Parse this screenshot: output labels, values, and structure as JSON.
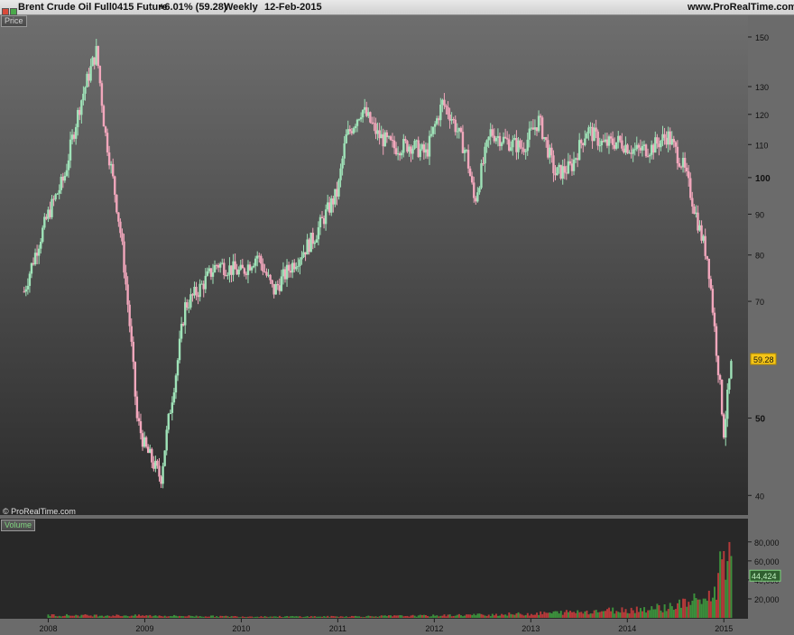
{
  "window": {
    "instrument": "Brent Crude Oil Full0415 Future",
    "change": "+6.01% (59.28)",
    "period": "Weekly",
    "date": "12-Feb-2015",
    "site": "www.ProRealTime.com"
  },
  "panes": {
    "price_label": "Price",
    "volume_label": "Volume",
    "watermark": "© ProRealTime.com"
  },
  "colors": {
    "up": "#9fe3b8",
    "down": "#f2a7bc",
    "vol_up": "#3c8f3c",
    "vol_down": "#b63a3a",
    "last_price_bg": "#f5c518"
  },
  "chart_data": [
    {
      "type": "candlestick",
      "title": "Price",
      "scale": "log",
      "ylim": [
        38,
        158
      ],
      "y_ticks": [
        40,
        50,
        70,
        80,
        90,
        100,
        110,
        120,
        130,
        150
      ],
      "x_ticks": [
        "2008",
        "2009",
        "2010",
        "2011",
        "2012",
        "2013",
        "2014",
        "2015"
      ],
      "last_price": "59.28",
      "x": [
        "2007-10",
        "2008-01",
        "2008-03",
        "2008-05",
        "2008-07",
        "2008-08",
        "2008-10",
        "2008-12",
        "2009-01",
        "2009-03",
        "2009-05",
        "2009-06",
        "2009-08",
        "2009-10",
        "2010-01",
        "2010-03",
        "2010-05",
        "2010-07",
        "2010-10",
        "2011-01",
        "2011-02",
        "2011-04",
        "2011-06",
        "2011-08",
        "2011-10",
        "2011-12",
        "2012-02",
        "2012-03",
        "2012-05",
        "2012-06",
        "2012-08",
        "2012-10",
        "2012-12",
        "2013-02",
        "2013-04",
        "2013-06",
        "2013-08",
        "2013-10",
        "2013-12",
        "2014-02",
        "2014-04",
        "2014-06",
        "2014-08",
        "2014-10",
        "2014-11",
        "2014-12",
        "2015-01",
        "2015-02"
      ],
      "close": [
        72,
        90,
        100,
        124,
        144,
        115,
        85,
        50,
        46,
        42,
        58,
        69,
        73,
        78,
        76,
        80,
        72,
        77,
        84,
        96,
        112,
        122,
        113,
        109,
        110,
        107,
        124,
        120,
        107,
        93,
        114,
        111,
        109,
        118,
        101,
        103,
        115,
        110,
        111,
        108,
        109,
        113,
        103,
        86,
        79,
        62,
        48,
        59
      ]
    },
    {
      "type": "bar",
      "title": "Volume",
      "ylim": [
        0,
        95000
      ],
      "y_ticks": [
        20000,
        40000,
        60000,
        80000
      ],
      "y_tick_labels": [
        "20,000",
        "40,000",
        "60,000",
        "80,000"
      ],
      "last_value": "44,424",
      "x": [
        "2008-01",
        "2009-01",
        "2010-01",
        "2011-01",
        "2012-01",
        "2013-01",
        "2013-06",
        "2014-01",
        "2014-06",
        "2014-09",
        "2014-11",
        "2014-12",
        "2015-01",
        "2015-02"
      ],
      "values": [
        3000,
        2500,
        1500,
        1500,
        2500,
        4500,
        6500,
        9000,
        12000,
        18000,
        22000,
        28000,
        87000,
        44424
      ]
    }
  ]
}
